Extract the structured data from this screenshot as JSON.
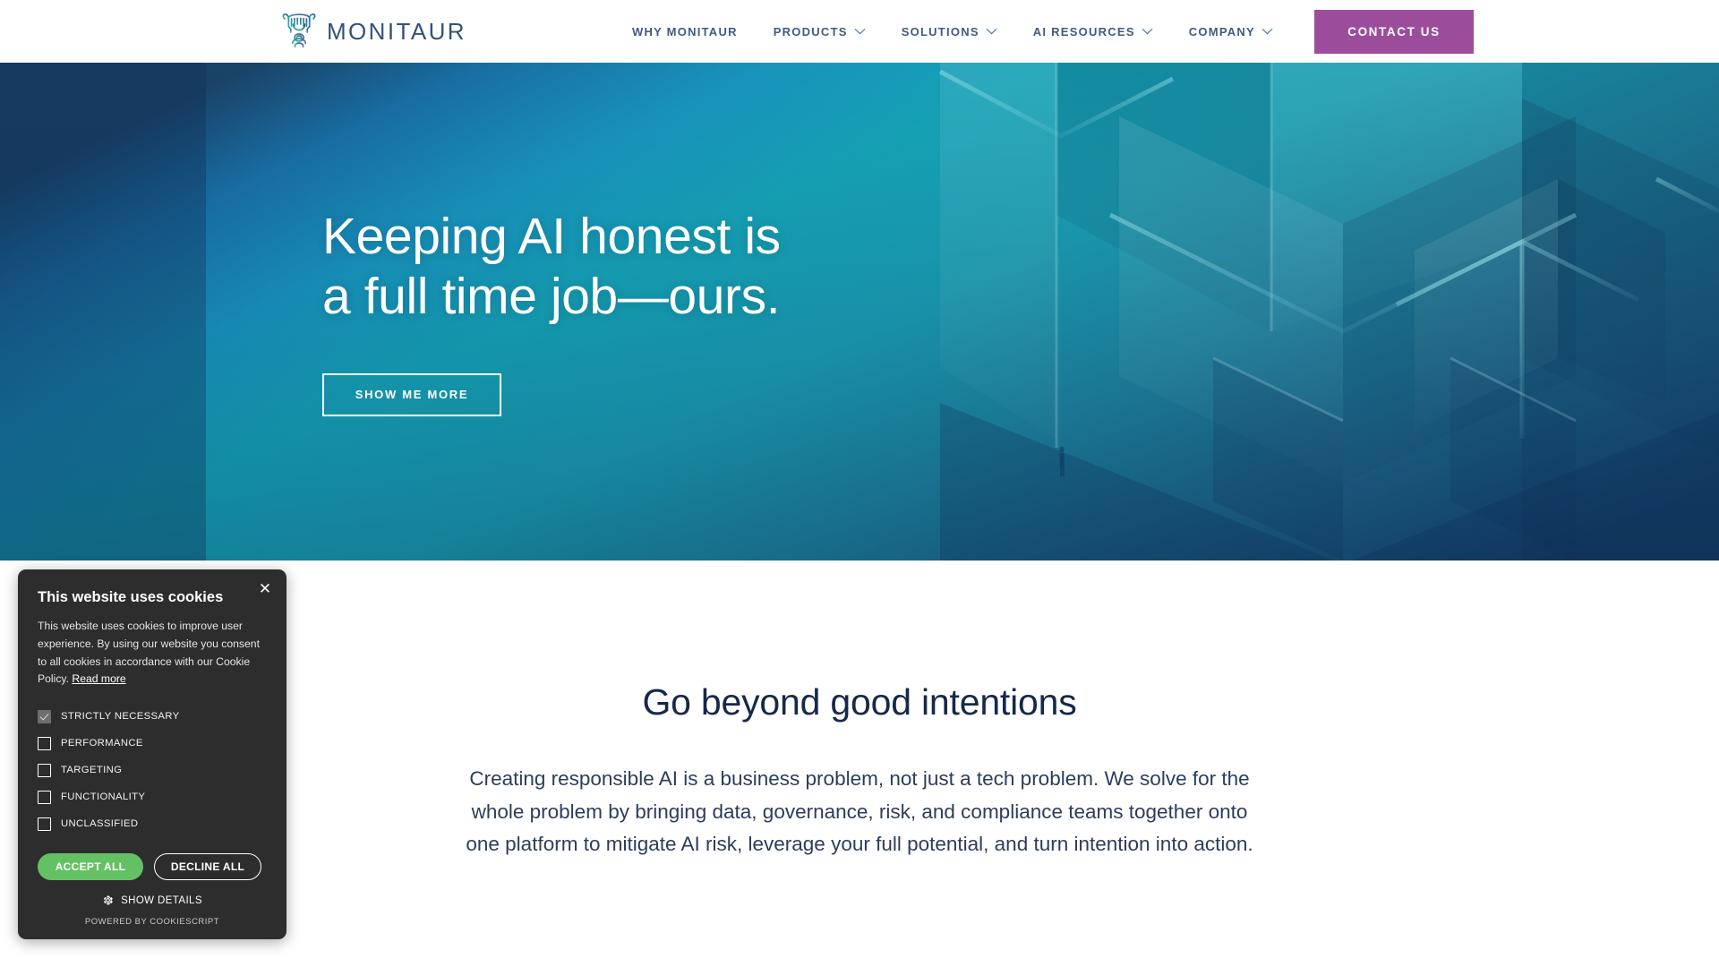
{
  "header": {
    "logo": {
      "text": "MONITAUR",
      "icon": "bull-head-logo-icon"
    },
    "nav": [
      {
        "label": "WHY MONITAUR",
        "caret": false
      },
      {
        "label": "PRODUCTS",
        "caret": true
      },
      {
        "label": "SOLUTIONS",
        "caret": true
      },
      {
        "label": "AI RESOURCES",
        "caret": true
      },
      {
        "label": "COMPANY",
        "caret": true
      }
    ],
    "cta": {
      "label": "CONTACT US",
      "color": "#9b4d9b"
    }
  },
  "hero": {
    "title_line1": "Keeping AI honest is",
    "title_line2": "a full time job—ours.",
    "button": "SHOW ME MORE",
    "colors": {
      "deep_navy": "#123a63",
      "teal": "#1590b4",
      "cyan": "#17a2b8",
      "dark_edge": "#0d2a4d"
    }
  },
  "content": {
    "title": "Go beyond good intentions",
    "body": "Creating responsible AI is a business problem, not just a tech problem. We solve for the whole problem by bringing data, governance, risk, and compliance teams together onto one platform to mitigate AI risk, leverage your full potential, and turn intention into action."
  },
  "cookie_banner": {
    "close_label": "✕",
    "title": "This website uses cookies",
    "description": "This website uses cookies to improve user experience. By using our website you consent to all cookies in accordance with our Cookie Policy.",
    "read_more": "Read more",
    "options": [
      {
        "label": "STRICTLY NECESSARY",
        "checked": true
      },
      {
        "label": "PERFORMANCE",
        "checked": false
      },
      {
        "label": "TARGETING",
        "checked": false
      },
      {
        "label": "FUNCTIONALITY",
        "checked": false
      },
      {
        "label": "UNCLASSIFIED",
        "checked": false
      }
    ],
    "accept_label": "ACCEPT ALL",
    "decline_label": "DECLINE ALL",
    "details_label": "SHOW DETAILS",
    "powered_by": "POWERED BY COOKIESCRIPT",
    "accent_green": "#64c163"
  }
}
